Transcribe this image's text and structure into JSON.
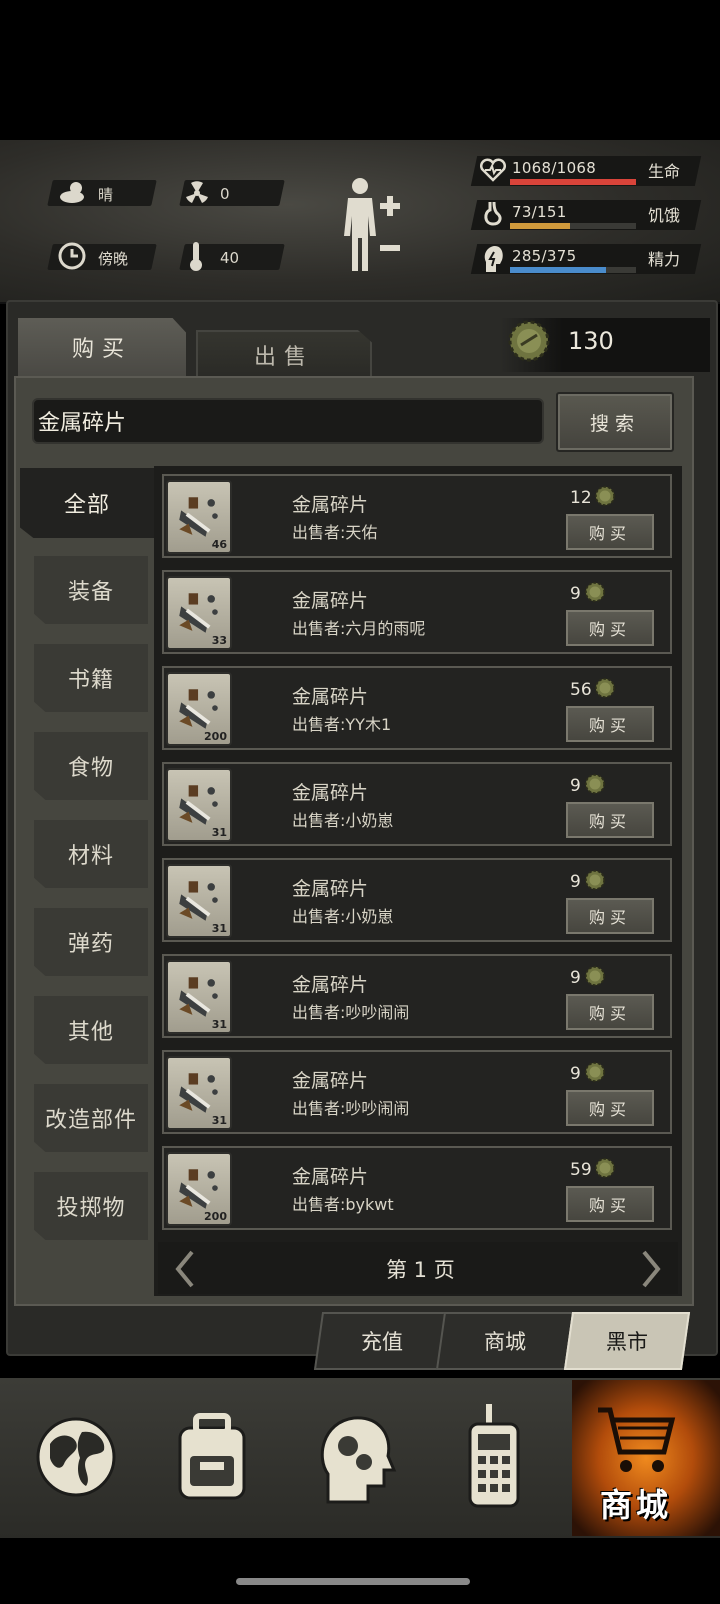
{
  "status": {
    "weather": "晴",
    "radiation": "0",
    "time_of_day": "傍晚",
    "temperature": "40",
    "health": {
      "value": "1068/1068",
      "label": "生命",
      "fraction": 1.0,
      "color": "#d9443a"
    },
    "hunger": {
      "value": "73/151",
      "label": "饥饿",
      "fraction": 0.48,
      "color": "#d09a3c"
    },
    "energy": {
      "value": "285/375",
      "label": "精力",
      "fraction": 0.76,
      "color": "#4a8ccc"
    }
  },
  "tabs": {
    "buy": "购买",
    "sell": "出售"
  },
  "coins": "130",
  "search": {
    "value": "金属碎片",
    "button": "搜索"
  },
  "categories": [
    "全部",
    "装备",
    "书籍",
    "食物",
    "材料",
    "弹药",
    "其他",
    "改造部件",
    "投掷物"
  ],
  "listings": [
    {
      "name": "金属碎片",
      "seller": "出售者:天佑",
      "price": "12",
      "qty": "46",
      "buy": "购买"
    },
    {
      "name": "金属碎片",
      "seller": "出售者:六月的雨呢",
      "price": "9",
      "qty": "33",
      "buy": "购买"
    },
    {
      "name": "金属碎片",
      "seller": "出售者:YY木1",
      "price": "56",
      "qty": "200",
      "buy": "购买"
    },
    {
      "name": "金属碎片",
      "seller": "出售者:小奶崽",
      "price": "9",
      "qty": "31",
      "buy": "购买"
    },
    {
      "name": "金属碎片",
      "seller": "出售者:小奶崽",
      "price": "9",
      "qty": "31",
      "buy": "购买"
    },
    {
      "name": "金属碎片",
      "seller": "出售者:吵吵闹闹",
      "price": "9",
      "qty": "31",
      "buy": "购买"
    },
    {
      "name": "金属碎片",
      "seller": "出售者:吵吵闹闹",
      "price": "9",
      "qty": "31",
      "buy": "购买"
    },
    {
      "name": "金属碎片",
      "seller": "出售者:bykwt",
      "price": "59",
      "qty": "200",
      "buy": "购买"
    }
  ],
  "pager": {
    "label": "第 1 页"
  },
  "market_tabs": [
    "充值",
    "商城",
    "黑市"
  ],
  "nav": {
    "shop_label": "商城"
  }
}
